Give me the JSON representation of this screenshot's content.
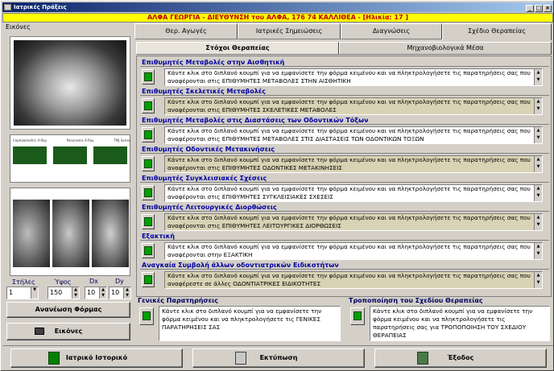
{
  "window": {
    "title": "Ιατρικές Πράξεις"
  },
  "patient": {
    "banner": "ΑΛΦΑ ΓΕΩΡΓΙΑ - ΔΙΕΥΘΥΝΣΗ του ΑΛΦΑ, 176 74 ΚΑΛΛΙΘΕΑ - [Ηλικία: 17 ]"
  },
  "left": {
    "header": "Εικόνες",
    "thumb_labels": [
      "Cephalometric X-Ray",
      "Panoramic X-Ray",
      "TMJ Series"
    ],
    "labels": {
      "cols": "Στήλες",
      "height": "Ύψος",
      "dx": "Dx",
      "dy": "Dy"
    },
    "values": {
      "cols": "1",
      "height": "150",
      "dx": "10",
      "dy": "10"
    },
    "refresh_label": "Ανανέωση Φόρμας",
    "images_label": "Εικόνες"
  },
  "tabs": [
    {
      "label": "Θερ. Αγωγές"
    },
    {
      "label": "Ιατρικές Σημειώσεις"
    },
    {
      "label": "Διαγνώσεις"
    },
    {
      "label": "Σχέδιο Θεραπείας"
    }
  ],
  "subtabs": [
    {
      "label": "Στόχοι Θεραπείας"
    },
    {
      "label": "Μηχανοβιολογικά Μέσα"
    }
  ],
  "sections": [
    {
      "title": "Επιθυμητές Μεταβολές στην Αισθητική",
      "text": "Κάντε κλικ στο διπλανό κουμπί για να εμφανίσετε την φόρμα κειμένου και να πληκτρολογήσετε τις παρατηρήσεις σας που αναφέρονται στις ΕΠΙΘΥΜΗΤΕΣ ΜΕΤΑΒΟΛΕΣ ΣΤΗΝ ΑΙΣΘΗΤΙΚΗ"
    },
    {
      "title": "Επιθυμητές Σκελετικές Μεταβολές",
      "text": "Κάντε κλικ στο διπλανό κουμπί για να εμφανίσετε την φόρμα κειμένου και να πληκτρολογήσετε τις παρατηρήσεις σας που αναφέρονται στις ΕΠΙΘΥΜΗΤΕΣ ΣΚΕΛΕΤΙΚΕΣ ΜΕΤΑΒΟΛΕΣ"
    },
    {
      "title": "Επιθυμητές Μεταβολές στις Διαστάσεις των Οδοντικών Τόξων",
      "text": "Κάντε κλικ στο διπλανό κουμπί για να εμφανίσετε την φόρμα κειμένου και να πληκτρολογήσετε τις παρατηρήσεις σας που αναφέρονται στις ΕΠΙΘΥΜΗΤΕΣ ΜΕΤΑΒΟΛΕΣ ΣΤΙΣ ΔΙΑΣΤΑΣΕΙΣ ΤΩΝ ΟΔΟΝΤΙΚΩΝ ΤΟΞΩΝ"
    },
    {
      "title": "Επιθυμητές Οδοντικές Μετακινήσεις",
      "text": "Κάντε κλικ στο διπλανό κουμπί για να εμφανίσετε την φόρμα κειμένου και να πληκτρολογήσετε τις παρατηρήσεις σας που αναφέρονται στις ΕΠΙΘΥΜΗΤΕΣ ΟΔΟΝΤΙΚΕΣ ΜΕΤΑΚΙΝΗΣΕΙΣ"
    },
    {
      "title": "Επιθυμητές Συγκλεισιακές Σχέσεις",
      "text": "Κάντε κλικ στο διπλανό κουμπί για να εμφανίσετε την φόρμα κειμένου και να πληκτρολογήσετε τις παρατηρήσεις σας που αναφέρονται στις ΕΠΙΘΥΜΗΤΕΣ ΣΥΓΚΛΕΙΣΙΑΚΕΣ ΣΧΕΣΕΙΣ"
    },
    {
      "title": "Επιθυμητές Λειτουργικές Διορθώσεις",
      "text": "Κάντε κλικ στο διπλανό κουμπί για να εμφανίσετε την φόρμα κειμένου και να πληκτρολογήσετε τις παρατηρήσεις σας που αναφέρονται στις ΕΠΙΘΥΜΗΤΕΣ ΛΕΙΤΟΥΡΓΙΚΕΣ ΔΙΟΡΘΩΣΕΙΣ"
    },
    {
      "title": "Εξακτική",
      "text": "Κάντε κλικ στο διπλανό κουμπί για να εμφανίσετε την φόρμα κειμένου και να πληκτρολογήσετε τις παρατηρήσεις σας που αναφέρονται στην ΕΞΑΚΤΙΚΗ"
    },
    {
      "title": "Αναγκαία Συμβολή άλλων οδοντιατρικών Ειδικοτήτων",
      "text": "Κάντε κλικ στο διπλανό κουμπί για να εμφανίσετε την φόρμα κειμένου και να πληκτρολογήσετε τις παρατηρήσεις σας που αναφέρεστε σε άλλες ΟΔΟΝΤΙΑΤΡΙΚΕΣ ΕΙΔΙΚΟΤΗΤΕΣ"
    }
  ],
  "general": {
    "title": "Γενικές Παρατηρήσεις",
    "text": "Κάντε κλικ στο διπλανό κουμπί για να εμφανίσετε την φόρμα κειμένου και να πληκτρολογήσετε τις ΓΕΝΙΚΕΣ ΠΑΡΑΤΗΡΗΣΕΙΣ ΣΑΣ"
  },
  "modification": {
    "title": "Τροποποίηση του Σχεδίου Θεραπείας",
    "text": "Κάντε κλικ στο διπλανό κουμπί για να εμφανίσετε την φόρμα κειμένου και να πληκτρολογήσετε τις παρατηρήσεις σας για ΤΡΟΠΟΠΟΙΗΣΗ ΤΟΥ ΣΧΕΔΙΟΥ ΘΕΡΑΠΕΙΑΣ"
  },
  "footer": {
    "history": "Ιατρικό Ιστορικό",
    "print": "Εκτύπωση",
    "exit": "Έξοδος"
  }
}
